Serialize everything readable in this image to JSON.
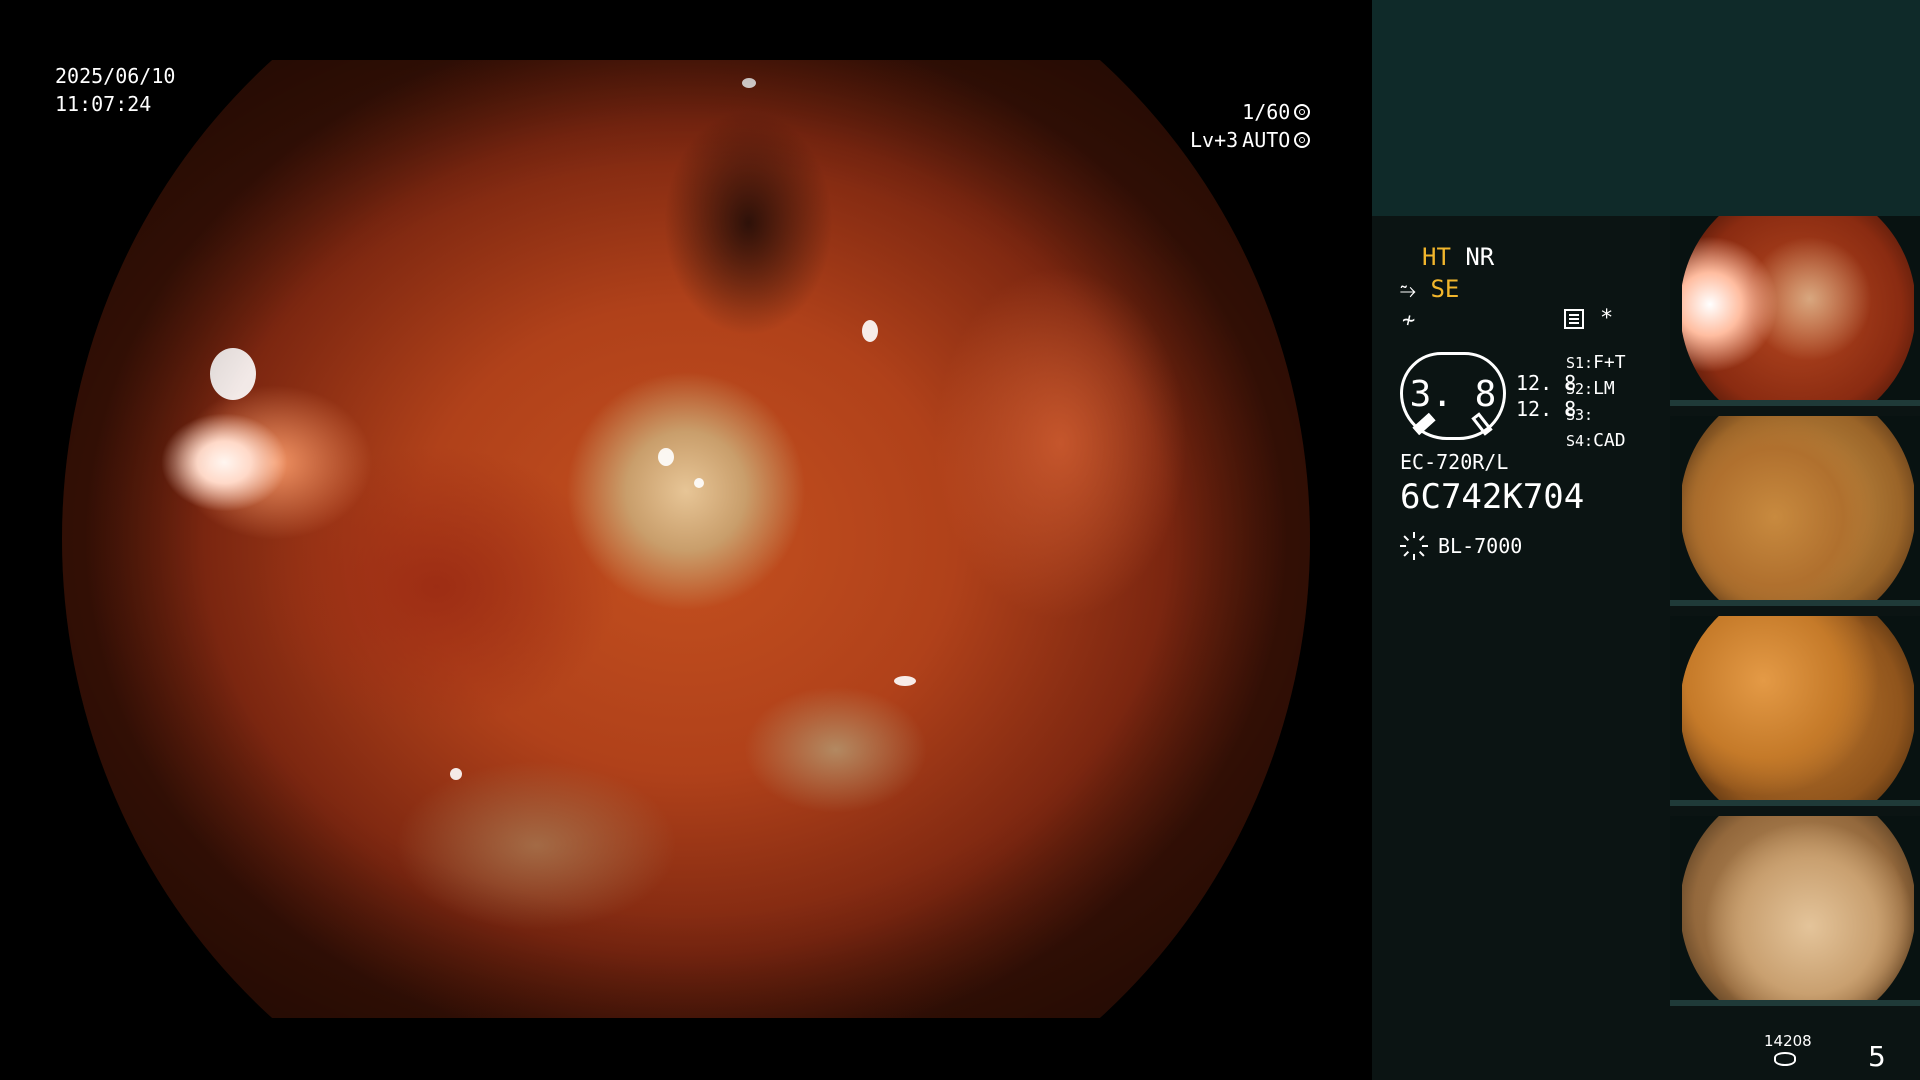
{
  "overlay": {
    "date": "2025/06/10",
    "time": "11:07:24",
    "shutter": "1/60",
    "level": "Lv+3",
    "mode": "AUTO"
  },
  "panel": {
    "ht": "HT",
    "nr": "NR",
    "se": "SE",
    "asterisk": "*",
    "gauge_value": "3. 8",
    "values": [
      "12. 8",
      "12. 8"
    ],
    "settings": [
      {
        "key": "S1:",
        "value": "F+T"
      },
      {
        "key": "S2:",
        "value": "LM"
      },
      {
        "key": "S3:",
        "value": ""
      },
      {
        "key": "S4:",
        "value": "CAD"
      }
    ],
    "scope_model": "EC-720R/L",
    "scope_serial": "6C742K704",
    "lamp": "BL-7000",
    "counter_small": "14208",
    "counter_big": "5"
  },
  "icons": {
    "shutter_icon": "aperture-icon",
    "auto_icon": "auto-exposure-icon",
    "se_icon": "freeze-icon",
    "f_icon": "function-icon",
    "menu_icon": "menu-icon",
    "lamp_icon": "sun-icon",
    "storage_icon": "storage-icon"
  },
  "colors": {
    "accent": "#f2b62c",
    "panel_bg": "#0b1413",
    "panel_top": "#0f2a29"
  }
}
